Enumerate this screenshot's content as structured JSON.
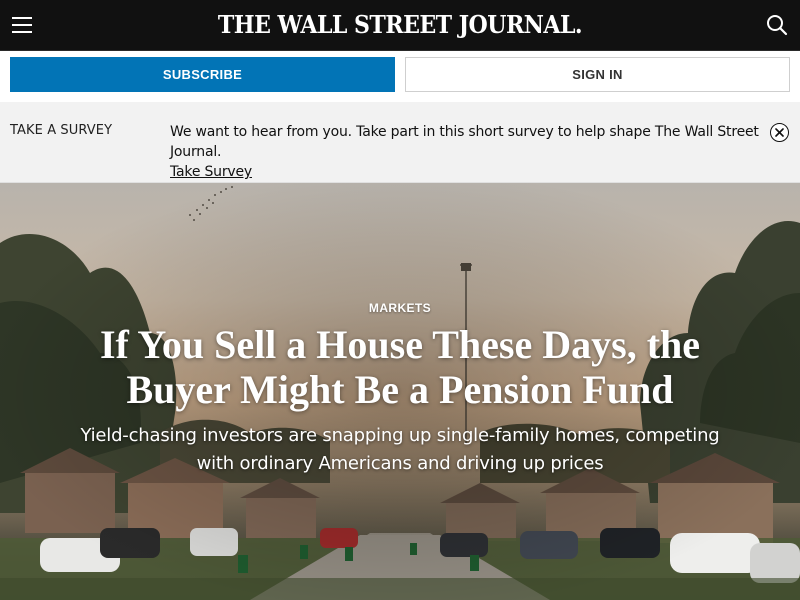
{
  "header": {
    "menu_icon": "hamburger-menu-icon",
    "masthead": "THE WALL STREET JOURNAL.",
    "search_icon": "search-icon",
    "background": "#111111"
  },
  "auth": {
    "subscribe_label": "SUBSCRIBE",
    "signin_label": "SIGN IN",
    "subscribe_color": "#0274b6"
  },
  "survey": {
    "label": "TAKE A SURVEY",
    "message": "We want to hear from you. Take part in this short survey to help shape The Wall Street Journal.",
    "link_text": "Take Survey",
    "close_icon": "close-circle-icon"
  },
  "hero": {
    "category": "MARKETS",
    "headline": "If You Sell a House These Days, the Buyer Might Be a Pension Fund",
    "dek": "Yield-chasing investors are snapping up single-family homes, competing with ordinary Americans and driving up prices",
    "image_subject": "suburban-neighborhood-photo"
  }
}
